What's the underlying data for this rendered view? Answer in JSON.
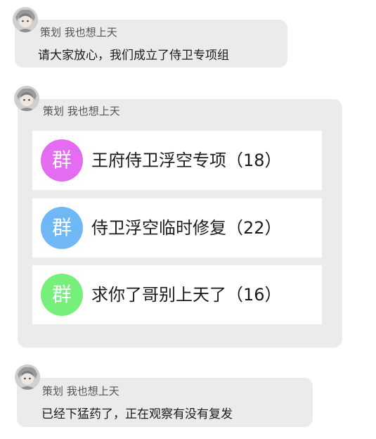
{
  "messages": [
    {
      "sender": "策划 我也想上天",
      "avatar_icon": "anime-character-avatar-icon",
      "text": "请大家放心，我们成立了侍卫专项组"
    },
    {
      "sender": "策划 我也想上天",
      "avatar_icon": "anime-character-avatar-icon",
      "groups": [
        {
          "badge": "群",
          "name": "王府侍卫浮空专项（18）",
          "color": "#e36cf0"
        },
        {
          "badge": "群",
          "name": "侍卫浮空临时修复（22）",
          "color": "#6fb7f5"
        },
        {
          "badge": "群",
          "name": "求你了哥别上天了（16）",
          "color": "#76f07a"
        }
      ]
    },
    {
      "sender": "策划 我也想上天",
      "avatar_icon": "anime-character-avatar-icon",
      "text": "已经下猛药了，正在观察有没有复发"
    }
  ]
}
